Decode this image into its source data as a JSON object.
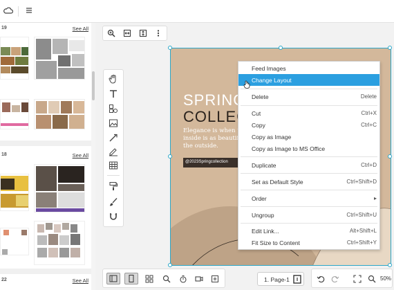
{
  "topbar": {
    "icons": [
      "cloud-icon",
      "menu-icon"
    ]
  },
  "left_panel": {
    "sections": [
      {
        "number": "19",
        "see_all": "See All"
      },
      {
        "number": "18",
        "see_all": "See All"
      },
      {
        "number": "22",
        "see_all": "See All"
      }
    ]
  },
  "canvas": {
    "heading_line1": "SPRING",
    "heading_line2": "COLLEC",
    "body_text": "Elegance is when the inside is as beautiful as the outside.",
    "tag": "@2023Springcollection"
  },
  "context_menu": {
    "items": [
      {
        "label": "Feed Images",
        "shortcut": ""
      },
      {
        "label": "Change Layout",
        "shortcut": ""
      },
      {
        "label": "Delete",
        "shortcut": "Delete"
      },
      {
        "label": "Cut",
        "shortcut": "Ctrl+X"
      },
      {
        "label": "Copy",
        "shortcut": "Ctrl+C"
      },
      {
        "label": "Copy as Image",
        "shortcut": ""
      },
      {
        "label": "Copy as Image to MS Office",
        "shortcut": ""
      },
      {
        "label": "Duplicate",
        "shortcut": "Ctrl+D"
      },
      {
        "label": "Set as Default Style",
        "shortcut": "Ctrl+Shift+D"
      },
      {
        "label": "Order",
        "shortcut": "▸"
      },
      {
        "label": "Ungroup",
        "shortcut": "Ctrl+Shift+U"
      },
      {
        "label": "Edit Link...",
        "shortcut": "Alt+Shift+L"
      },
      {
        "label": "Fit Size to Content",
        "shortcut": "Ctrl+Shift+Y"
      }
    ]
  },
  "bottom": {
    "page_label": "1. Page-1",
    "zoom": "50%"
  },
  "colors": {
    "accent": "#2b9fe0",
    "canvas_bg": "#d3b89b",
    "selection": "#2aa7c9"
  }
}
